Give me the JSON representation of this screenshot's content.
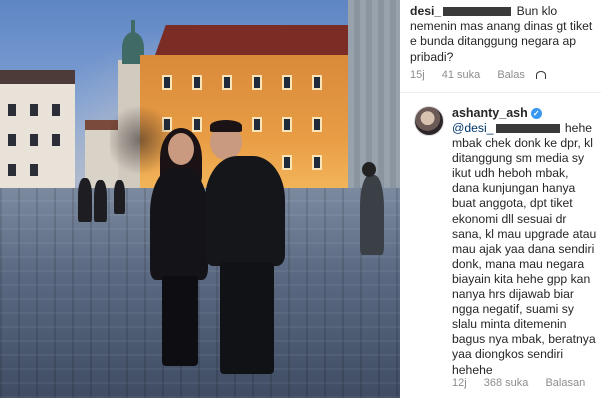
{
  "photo": {
    "description_icon": "photo-image"
  },
  "comment_1": {
    "username": "desi_",
    "text": "Bun klo nemenin mas anang dinas gt tiket e bunda ditanggung negara ap pribadi?",
    "time": "15j",
    "likes": "41 suka",
    "reply_label": "Balas"
  },
  "comment_2": {
    "username": "ashanty_ash",
    "mention": "@desi_",
    "text": "hehe mbak chek donk ke dpr, kl ditanggung sm media sy ikut udh heboh mbak, dana kunjungan hanya buat anggota, dpt tiket ekonomi dll sesuai dr sana, kl mau upgrade atau mau ajak yaa dana sendiri donk, mana mau negara biayain kita hehe gpp kan nanya hrs dijawab biar ngga negatif, suami sy slalu minta ditemenin bagus nya mbak, beratnya yaa diongkos sendiri hehehe",
    "time": "12j",
    "likes": "368 suka",
    "reply_label": "Balasan"
  },
  "colors": {
    "text": "#262626",
    "meta": "#8e8e8e",
    "verified": "#3897f0",
    "mention": "#003569"
  }
}
